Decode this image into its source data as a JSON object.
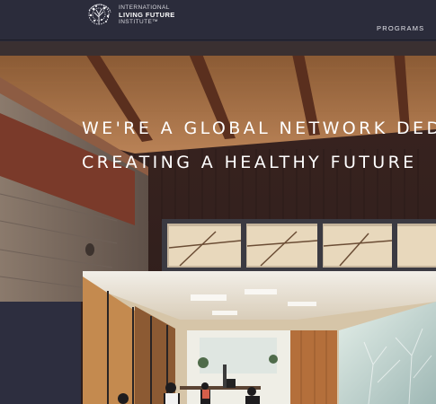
{
  "header": {
    "logo": {
      "line1": "INTERNATIONAL",
      "line2": "LIVING FUTURE",
      "line3": "INSTITUTE™",
      "icon": "tree-icon"
    },
    "nav": [
      {
        "label": "PROGRAMS"
      }
    ]
  },
  "hero": {
    "heading_line1": "WE'RE A GLOBAL NETWORK DED",
    "heading_line2": "CREATING A HEALTHY FUTURE",
    "image": "building-interior-photo"
  },
  "colors": {
    "header_bg": "#2b2c3b",
    "panel_bg": "#2d2e3f",
    "text": "#ffffff"
  }
}
